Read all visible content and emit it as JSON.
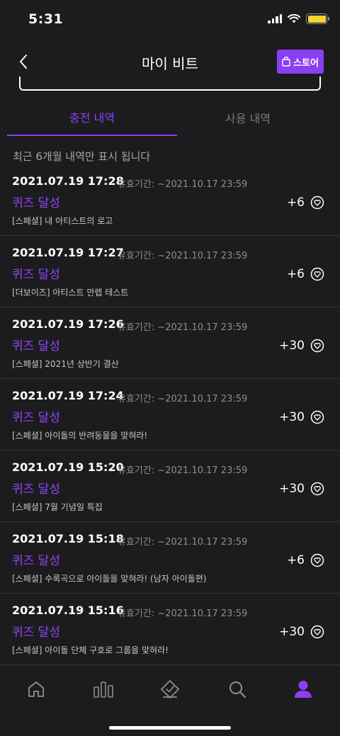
{
  "status": {
    "time": "5:31"
  },
  "nav": {
    "title": "마이 비트",
    "store_label": "스토어"
  },
  "tabs": [
    {
      "label": "충전 내역"
    },
    {
      "label": "사용 내역"
    }
  ],
  "notice": "최근 6개월 내역만 표시 됩니다",
  "items": [
    {
      "date": "2021.07.19 17:28",
      "expiry": "유효기간: ~2021.10.17 23:59",
      "title": "퀴즈 달성",
      "desc": "[스페셜] 내 아티스트의 로고",
      "amount": "+6"
    },
    {
      "date": "2021.07.19 17:27",
      "expiry": "유효기간: ~2021.10.17 23:59",
      "title": "퀴즈 달성",
      "desc": "[더보이즈] 아티스트 만렙 테스트",
      "amount": "+6"
    },
    {
      "date": "2021.07.19 17:26",
      "expiry": "유효기간: ~2021.10.17 23:59",
      "title": "퀴즈 달성",
      "desc": "[스페셜] 2021년 상반기 결산",
      "amount": "+30"
    },
    {
      "date": "2021.07.19 17:24",
      "expiry": "유효기간: ~2021.10.17 23:59",
      "title": "퀴즈 달성",
      "desc": "[스페셜] 아이돌의 반려동물을 맞혀라!",
      "amount": "+30"
    },
    {
      "date": "2021.07.19 15:20",
      "expiry": "유효기간: ~2021.10.17 23:59",
      "title": "퀴즈 달성",
      "desc": "[스페셜] 7월 기념일 특집",
      "amount": "+30"
    },
    {
      "date": "2021.07.19 15:18",
      "expiry": "유효기간: ~2021.10.17 23:59",
      "title": "퀴즈 달성",
      "desc": "[스페셜] 수록곡으로 아이돌을 맞혀라! (남자 아이돌편)",
      "amount": "+6"
    },
    {
      "date": "2021.07.19 15:16",
      "expiry": "유효기간: ~2021.10.17 23:59",
      "title": "퀴즈 달성",
      "desc": "[스페셜] 아이돌 단체 구호로 그룹을 맞혀라!",
      "amount": "+30"
    }
  ],
  "tabbar": [
    {
      "icon": "home-icon"
    },
    {
      "icon": "chart-icon"
    },
    {
      "icon": "ticket-check-icon"
    },
    {
      "icon": "search-icon"
    },
    {
      "icon": "profile-icon",
      "active": true
    }
  ],
  "colors": {
    "accent": "#8a3ff2",
    "background": "#1c1c1e",
    "inactive_icon": "#8e8e93"
  }
}
